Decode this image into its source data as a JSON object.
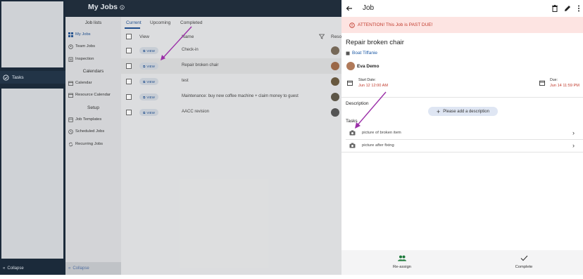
{
  "rail": {
    "tasks_label": "Tasks",
    "collapse_label": "Collapse"
  },
  "sidebar": {
    "section_job_lists": "Job lists",
    "section_calendars": "Calendars",
    "section_setup": "Setup",
    "items": [
      {
        "label": "My Jobs"
      },
      {
        "label": "Team Jobs"
      },
      {
        "label": "Inspection"
      },
      {
        "label": "Calendar"
      },
      {
        "label": "Resource Calendar"
      },
      {
        "label": "Job Templates"
      },
      {
        "label": "Scheduled Jobs"
      },
      {
        "label": "Recurring Jobs"
      }
    ],
    "collapse_label": "Collapse"
  },
  "main": {
    "title": "My Jobs",
    "tabs": [
      "Current",
      "Upcoming",
      "Completed"
    ],
    "columns": [
      "View",
      "Name",
      "Reso"
    ],
    "view_chip": "VIEW",
    "rows": [
      {
        "name": "Check-in"
      },
      {
        "name": "Repair broken chair"
      },
      {
        "name": "test"
      },
      {
        "name": "Maintenance: buy new coffee machine + claim money to guest"
      },
      {
        "name": "AACC revision"
      }
    ]
  },
  "panel": {
    "header": "Job",
    "alert": "ATTENTION! This Job is PAST DUE!",
    "job_title": "Repair broken chair",
    "location": "Boat Tiffanie",
    "assignee": "Eva Demo",
    "start_label": "Start Date:",
    "start_value": "Jun 12 12:00 AM",
    "due_label": "Due:",
    "due_value": "Jun 14 11:59 PM",
    "description_label": "Description",
    "description_button": "Please add a description",
    "tasks_label": "Tasks",
    "tasks": [
      {
        "label": "picture of broken item"
      },
      {
        "label": "picture after fixing"
      }
    ],
    "reassign_label": "Re-assign",
    "complete_label": "Complete"
  },
  "colors": {
    "accent": "#1d4f91",
    "alert_bg": "#fde4e2",
    "alert_text": "#c0392b",
    "annotation": "#9b2fa8"
  }
}
